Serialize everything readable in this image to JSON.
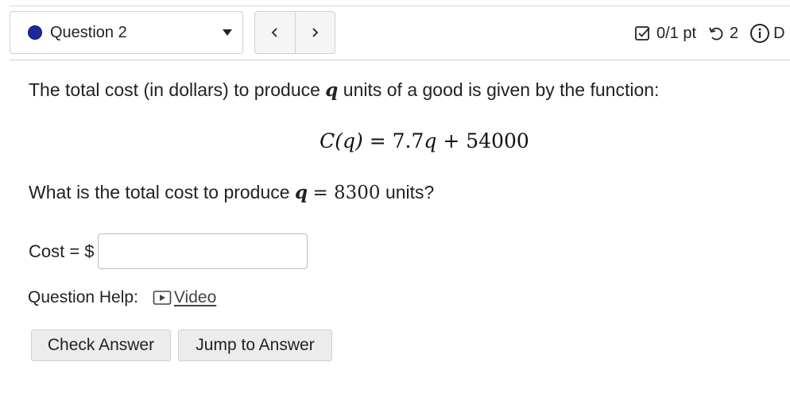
{
  "header": {
    "question_label": "Question 2",
    "score": "0/1 pt",
    "tries": "2",
    "clipped_text": "D"
  },
  "icons": {
    "status": "filled-circle-icon",
    "dropdown": "caret-down-icon",
    "prev": "chevron-left-icon",
    "next": "chevron-right-icon",
    "score": "checkbox-icon",
    "retry": "retry-icon",
    "info": "info-icon",
    "video": "play-icon"
  },
  "colors": {
    "status_dot": "#1c2a9c",
    "button_bg": "#ececec"
  },
  "question": {
    "intro_before": "The total cost (in dollars) to produce ",
    "intro_var": "q",
    "intro_after": " units of a good is given by the function:",
    "formula_lhs": "C(q)",
    "formula_eq": "=",
    "formula_rhs_coef": "7.7",
    "formula_rhs_var": "q",
    "formula_rhs_rest": "+ 54000",
    "ask_before": "What is the total cost to produce ",
    "ask_var": "q",
    "ask_eq": "= 8300",
    "ask_after": " units?"
  },
  "answer": {
    "label": "Cost = $",
    "value": "",
    "placeholder": ""
  },
  "help": {
    "label": "Question Help:",
    "video_label": "Video"
  },
  "buttons": {
    "check": "Check Answer",
    "jump": "Jump to Answer"
  }
}
